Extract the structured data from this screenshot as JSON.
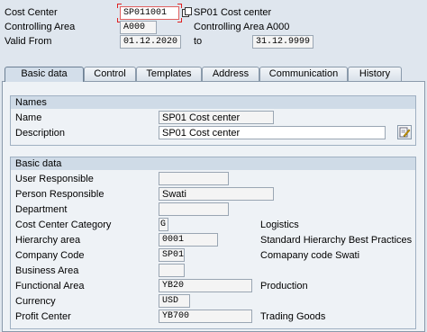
{
  "header": {
    "cost_center_label": "Cost Center",
    "cost_center_value": "SP011001",
    "cost_center_desc": "SP01 Cost center",
    "controlling_area_label": "Controlling Area",
    "controlling_area_value": "A000",
    "controlling_area_desc": "Controlling Area A000",
    "valid_from_label": "Valid From",
    "valid_from_value": "01.12.2020",
    "to_label": "to",
    "valid_to_value": "31.12.9999"
  },
  "tabs": [
    {
      "label": "Basic data",
      "active": true
    },
    {
      "label": "Control",
      "active": false
    },
    {
      "label": "Templates",
      "active": false
    },
    {
      "label": "Address",
      "active": false
    },
    {
      "label": "Communication",
      "active": false
    },
    {
      "label": "History",
      "active": false
    }
  ],
  "names": {
    "title": "Names",
    "name_label": "Name",
    "name_value": "SP01 Cost center",
    "description_label": "Description",
    "description_value": "SP01 Cost center"
  },
  "basic_data": {
    "title": "Basic data",
    "user_responsible_label": "User Responsible",
    "user_responsible_value": "",
    "person_responsible_label": "Person Responsible",
    "person_responsible_value": "Swati",
    "department_label": "Department",
    "department_value": "",
    "category_label": "Cost Center Category",
    "category_value": "G",
    "category_desc": "Logistics",
    "hierarchy_label": "Hierarchy area",
    "hierarchy_value": "0001",
    "hierarchy_desc": "Standard Hierarchy Best Practices",
    "company_code_label": "Company Code",
    "company_code_value": "SP01",
    "company_code_desc": "Comapany code Swati",
    "business_area_label": "Business Area",
    "business_area_value": "",
    "functional_area_label": "Functional Area",
    "functional_area_value": "YB20",
    "functional_area_desc": "Production",
    "currency_label": "Currency",
    "currency_value": "USD",
    "profit_center_label": "Profit Center",
    "profit_center_value": "YB700",
    "profit_center_desc": "Trading Goods"
  },
  "icons": {
    "copy": "copy-icon",
    "edit": "edit-text-icon"
  },
  "colors": {
    "background": "#dfe6ee",
    "group_header": "#cfdbe7",
    "focus_border": "#e02020"
  }
}
